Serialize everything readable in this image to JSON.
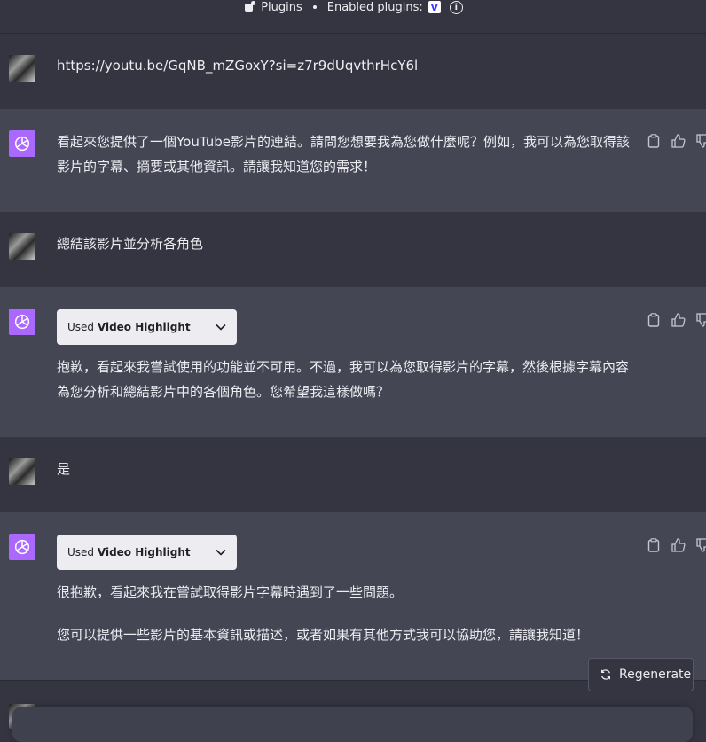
{
  "topbar": {
    "plugins_label": "Plugins",
    "enabled_label": "Enabled plugins:",
    "plugin_badge": "V"
  },
  "messages": [
    {
      "role": "user",
      "text": "https://youtu.be/GqNB_mZGoxY?si=z7r9dUqvthrHcY6l"
    },
    {
      "role": "assistant",
      "text": "看起來您提供了一個YouTube影片的連結。請問您想要我為您做什麼呢？例如，我可以為您取得該影片的字幕、摘要或其他資訊。請讓我知道您的需求！"
    },
    {
      "role": "user",
      "text": "總結該影片並分析各角色"
    },
    {
      "role": "assistant",
      "plugin_used": "Used",
      "plugin_name": "Video Highlight",
      "text": "抱歉，看起來我嘗試使用的功能並不可用。不過，我可以為您取得影片的字幕，然後根據字幕內容為您分析和總結影片中的各個角色。您希望我這樣做嗎？"
    },
    {
      "role": "user",
      "text": "是"
    },
    {
      "role": "assistant",
      "plugin_used": "Used",
      "plugin_name": "Video Highlight",
      "text_1": "很抱歉，看起來我在嘗試取得影片字幕時遇到了一些問題。",
      "text_2": "您可以提供一些影片的基本資訊或描述，或者如果有其他方式我可以協助您，請讓我知道！"
    }
  ],
  "regenerate_label": "Regenerate",
  "icons": {
    "accent_bot": "#ab68ff",
    "copy": "clipboard-icon",
    "like": "thumbs-up-icon",
    "dislike": "thumbs-down-icon"
  }
}
